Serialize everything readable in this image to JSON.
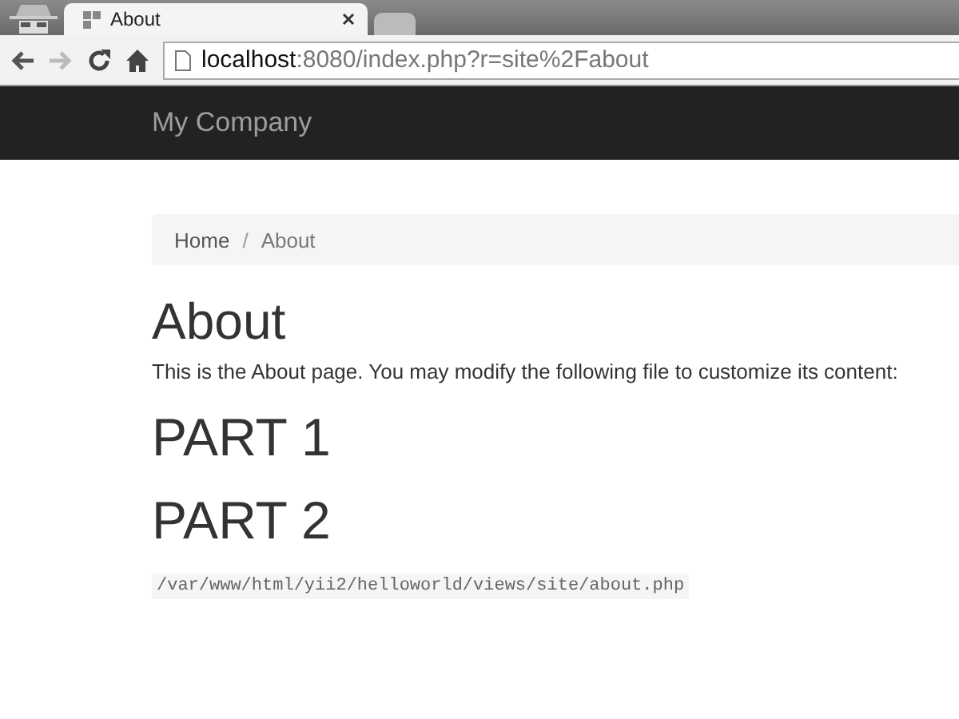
{
  "browser": {
    "tabs": [
      {
        "title": "About",
        "selected": true
      },
      {
        "selected": false
      }
    ],
    "address": {
      "host": "localhost",
      "rest": ":8080/index.php?r=site%2Fabout"
    }
  },
  "navbar": {
    "brand": "My Company"
  },
  "breadcrumb": [
    {
      "label": "Home",
      "selected": false
    },
    {
      "label": "About",
      "selected": true
    }
  ],
  "breadcrumb_separator": "/",
  "heading": "About",
  "intro": "This is the About page. You may modify the following file to customize its content:",
  "parts": [
    "PART 1",
    "PART 2"
  ],
  "code": "/var/www/html/yii2/helloworld/views/site/about.php"
}
